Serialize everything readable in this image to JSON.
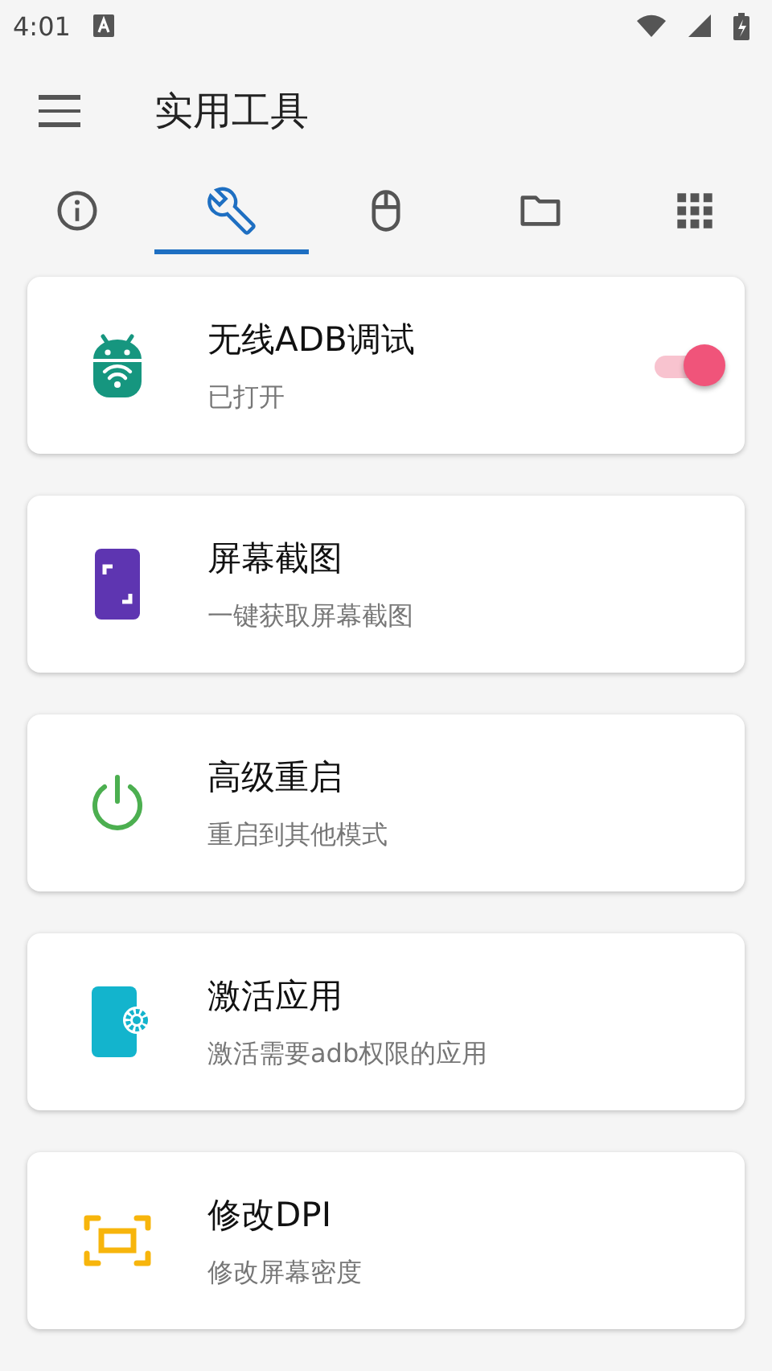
{
  "status_bar": {
    "time": "4:01"
  },
  "app_bar": {
    "title": "实用工具"
  },
  "tabs": [
    {
      "kind": "info",
      "selected": false
    },
    {
      "kind": "tools",
      "selected": true
    },
    {
      "kind": "mouse",
      "selected": false
    },
    {
      "kind": "folder",
      "selected": false
    },
    {
      "kind": "apps",
      "selected": false
    }
  ],
  "tools": [
    {
      "kind": "adb",
      "title": "无线ADB调试",
      "subtitle": "已打开",
      "on": true
    },
    {
      "kind": "screenshot",
      "title": "屏幕截图",
      "subtitle": "一键获取屏幕截图"
    },
    {
      "kind": "reboot",
      "title": "高级重启",
      "subtitle": "重启到其他模式"
    },
    {
      "kind": "activate",
      "title": "激活应用",
      "subtitle": "激活需要adb权限的应用"
    },
    {
      "kind": "dpi",
      "title": "修改DPI",
      "subtitle": "修改屏幕密度"
    }
  ]
}
